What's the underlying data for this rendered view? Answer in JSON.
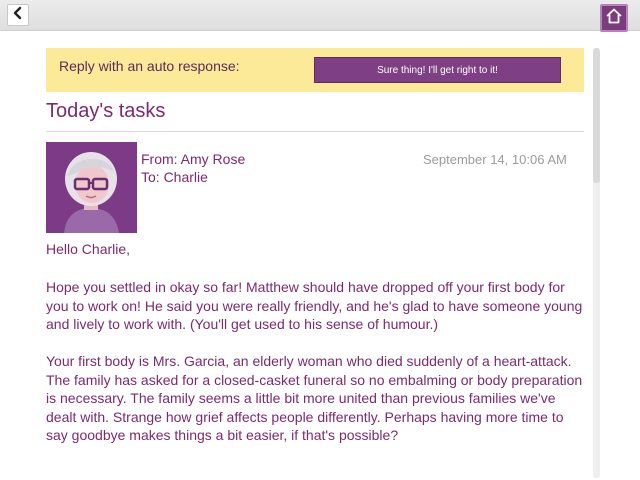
{
  "colors": {
    "accent": "#7a2b6e",
    "banner": "#fcea98",
    "button": "#7e3f85",
    "date": "#9b9b9b"
  },
  "icons": {
    "back": "chevron-left",
    "home": "house"
  },
  "auto_response": {
    "label": "Reply with an auto response:",
    "button_label": "Sure thing! I'll get right to it!"
  },
  "page_title": "Today's tasks",
  "email": {
    "from": "From: Amy Rose",
    "to": "To: Charlie",
    "date": "September 14, 10:06 AM",
    "greeting": "Hello Charlie,",
    "paragraphs": [
      "Hope you settled in okay so far! Matthew should have dropped off your first body for you to work on! He said you were really friendly, and he's glad to have someone young and lively to work with. (You'll get used to his sense of humour.)",
      "Your first body is Mrs. Garcia, an elderly woman who died suddenly of a heart-attack. The family has asked for a closed-casket funeral so no embalming or body preparation is necessary. The family seems a little bit more united than previous families we've dealt with. Strange how grief affects people differently. Perhaps having more time to say goodbye makes things a bit easier, if that's possible?"
    ]
  }
}
